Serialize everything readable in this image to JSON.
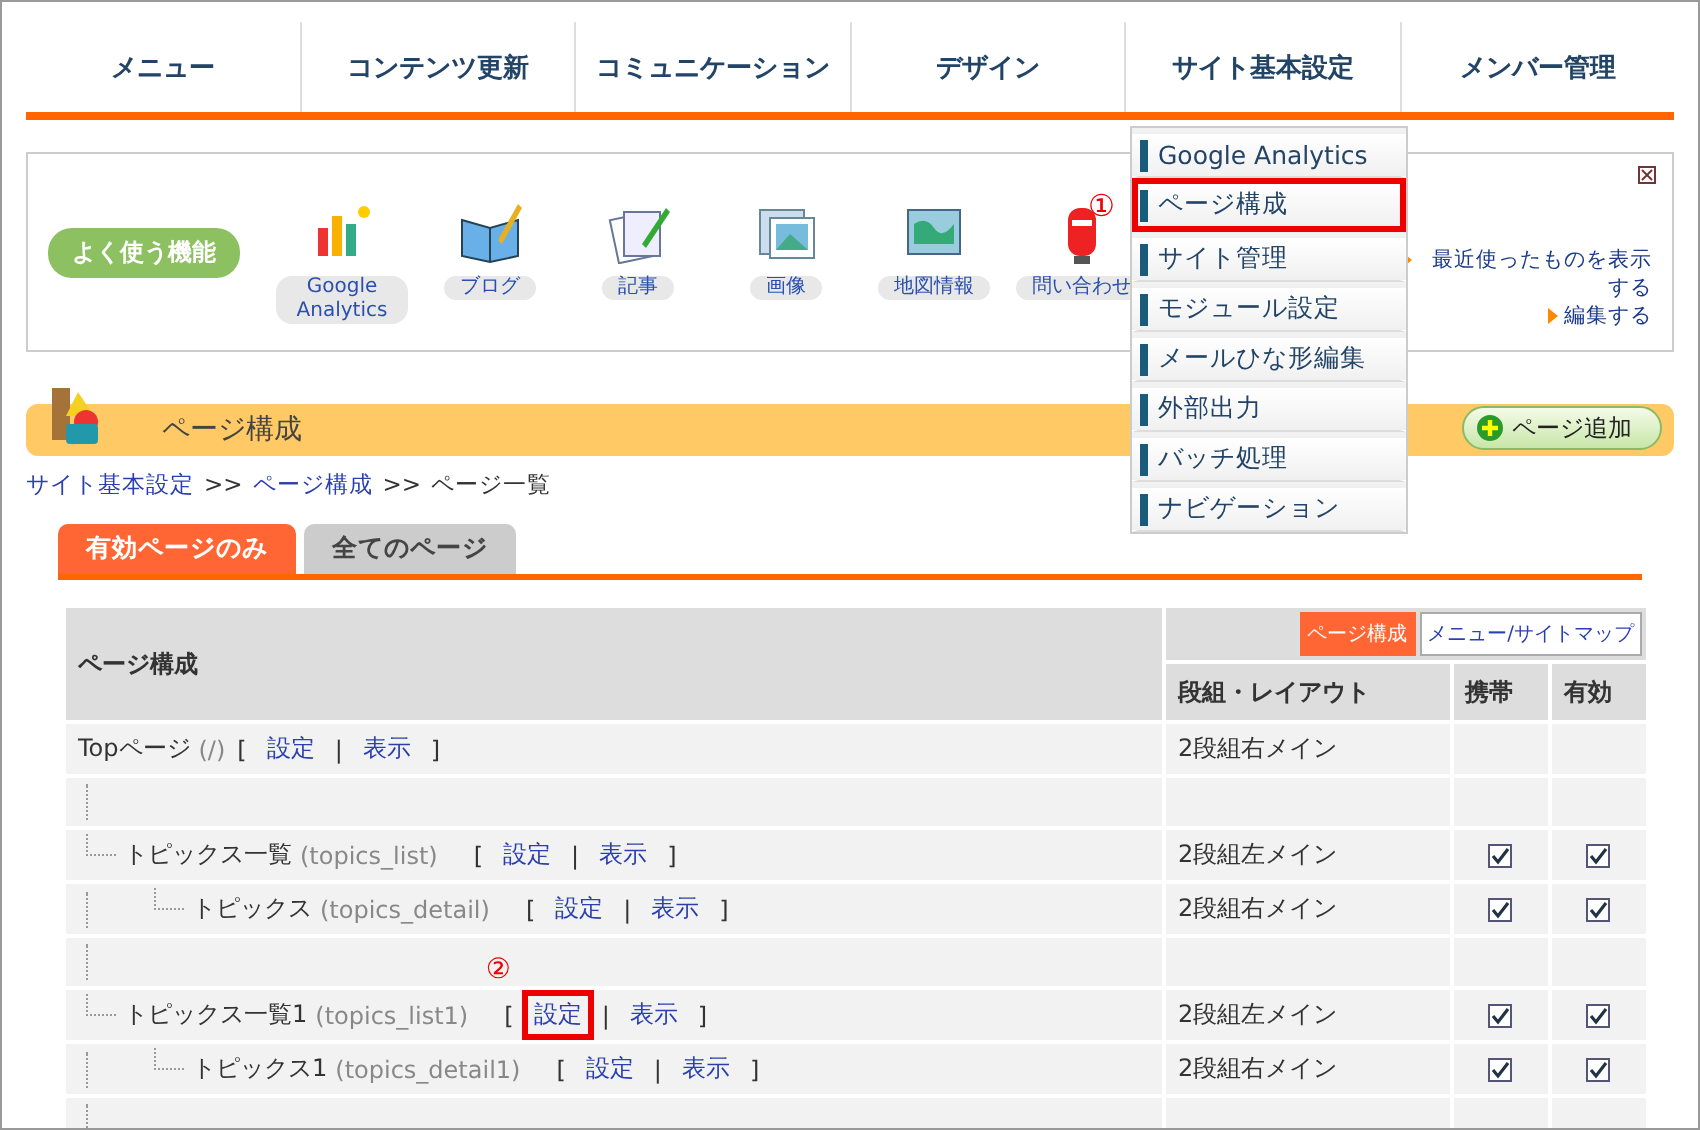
{
  "nav": [
    {
      "label": "メニュー"
    },
    {
      "label": "コンテンツ更新"
    },
    {
      "label": "コミュニケーション"
    },
    {
      "label": "デザイン"
    },
    {
      "label": "サイト基本設定"
    },
    {
      "label": "メンバー管理"
    }
  ],
  "dropdown": [
    {
      "label": "Google Analytics",
      "highlighted": false
    },
    {
      "label": "ページ構成",
      "highlighted": true,
      "callout": "①"
    },
    {
      "label": "サイト管理",
      "highlighted": false
    },
    {
      "label": "モジュール設定",
      "highlighted": false
    },
    {
      "label": "メールひな形編集",
      "highlighted": false
    },
    {
      "label": "外部出力",
      "highlighted": false
    },
    {
      "label": "バッチ処理",
      "highlighted": false
    },
    {
      "label": "ナビゲーション",
      "highlighted": false
    }
  ],
  "quick_access": {
    "label": "よく使う機能",
    "items": [
      {
        "kind": "chart",
        "label": "Google Analytics"
      },
      {
        "kind": "book",
        "label": "ブログ"
      },
      {
        "kind": "document",
        "label": "記事"
      },
      {
        "kind": "image",
        "label": "画像"
      },
      {
        "kind": "map",
        "label": "地図情報"
      },
      {
        "kind": "mailbox",
        "label": "問い合わせ"
      }
    ],
    "links": [
      "最近使ったものを表示する",
      "編集する"
    ]
  },
  "heading": {
    "title": "ページ構成",
    "add_button": "ページ追加"
  },
  "breadcrumb": [
    {
      "label": "サイト基本設定",
      "link": true
    },
    {
      "label": ">>",
      "link": false
    },
    {
      "label": "ページ構成",
      "link": true
    },
    {
      "label": ">>",
      "link": false
    },
    {
      "label": "ページ一覧",
      "link": false
    }
  ],
  "tabs": [
    {
      "label": "有効ページのみ",
      "selected": true
    },
    {
      "label": "全てのページ",
      "selected": false
    }
  ],
  "table": {
    "header": "ページ構成",
    "views": [
      {
        "label": "ページ構成",
        "selected": true
      },
      {
        "label": "メニュー/サイトマップ",
        "selected": false
      }
    ],
    "columns": [
      "段組・レイアウト",
      "携帯",
      "有効"
    ],
    "bracket_open": "[",
    "separator": "|",
    "bracket_close": "]",
    "rows": [
      {
        "name": "Topページ",
        "slug": "(/)",
        "links": [
          {
            "label": "設定",
            "highlighted": false
          },
          {
            "label": "表示",
            "highlighted": false
          }
        ],
        "layout": "2段組右メイン",
        "children": [
          {
            "name": "トピックス一覧",
            "slug": "(topics_list)",
            "links": [
              {
                "label": "設定",
                "highlighted": false
              },
              {
                "label": "表示",
                "highlighted": false
              }
            ],
            "layout": "2段組左メイン",
            "mobile": true,
            "enabled": true,
            "children": [
              {
                "name": "トピックス",
                "slug": "(topics_detail)",
                "links": [
                  {
                    "label": "設定",
                    "highlighted": false
                  },
                  {
                    "label": "表示",
                    "highlighted": false
                  }
                ],
                "layout": "2段組右メイン",
                "mobile": true,
                "enabled": true
              }
            ]
          },
          {
            "name": "トピックス一覧1",
            "slug": "(topics_list1)",
            "links": [
              {
                "label": "設定",
                "highlighted": true,
                "callout": "②"
              },
              {
                "label": "表示",
                "highlighted": false
              }
            ],
            "layout": "2段組左メイン",
            "mobile": true,
            "enabled": true,
            "children": [
              {
                "name": "トピックス1",
                "slug": "(topics_detail1)",
                "links": [
                  {
                    "label": "設定",
                    "highlighted": false
                  },
                  {
                    "label": "表示",
                    "highlighted": false
                  }
                ],
                "layout": "2段組右メイン",
                "mobile": true,
                "enabled": true
              }
            ]
          }
        ]
      }
    ]
  }
}
